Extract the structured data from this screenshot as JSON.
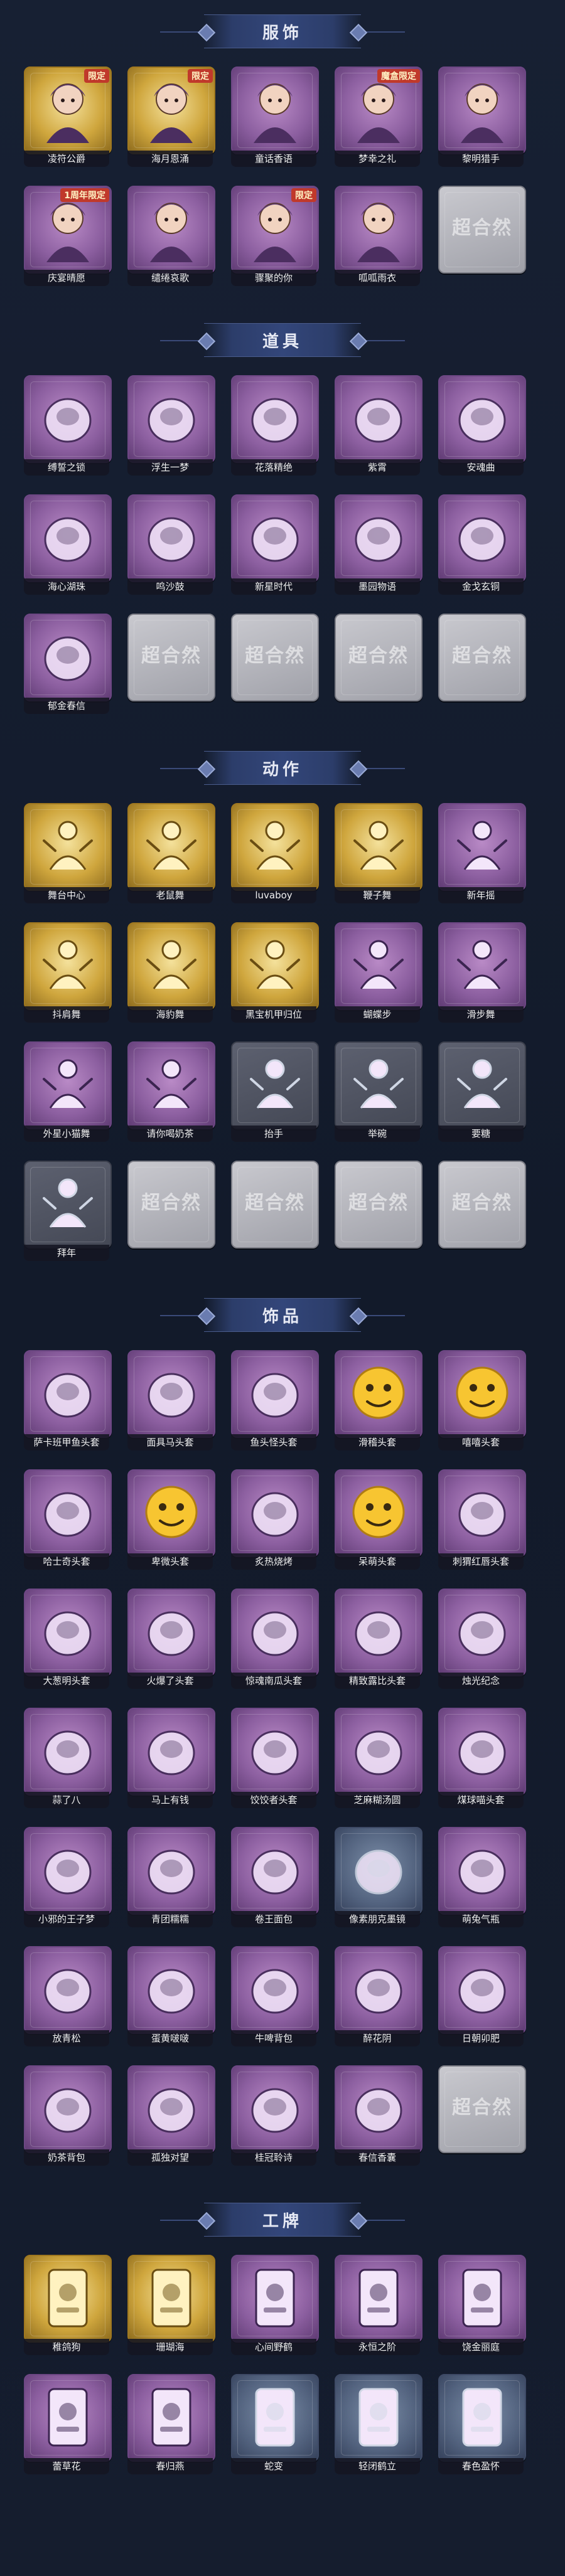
{
  "sections": [
    {
      "title": "服饰",
      "items": [
        {
          "label": "凌符公爵",
          "style": "gold",
          "tag": "限定",
          "icon": "costume-icon"
        },
        {
          "label": "海月恩涌",
          "style": "gold",
          "tag": "限定",
          "icon": "costume-icon"
        },
        {
          "label": "童话香语",
          "style": "purple",
          "tag": "",
          "icon": "costume-icon"
        },
        {
          "label": "梦幸之礼",
          "style": "purple",
          "tag": "魔盒限定",
          "icon": "costume-icon"
        },
        {
          "label": "黎明猎手",
          "style": "purple",
          "tag": "",
          "icon": "costume-icon"
        },
        {
          "label": "庆宴晴愿",
          "style": "purple",
          "tag": "1周年限定",
          "icon": "costume-icon"
        },
        {
          "label": "缱绻哀歌",
          "style": "purple",
          "tag": "",
          "icon": "costume-icon"
        },
        {
          "label": "骤聚的你",
          "style": "purple",
          "tag": "限定",
          "icon": "costume-icon"
        },
        {
          "label": "呱呱雨衣",
          "style": "purple",
          "tag": "",
          "icon": "costume-icon"
        },
        {
          "label": "",
          "style": "placeholder",
          "tag": "",
          "icon": "watermark-icon"
        }
      ]
    },
    {
      "title": "道具",
      "items": [
        {
          "label": "缚誓之锁",
          "style": "purple",
          "tag": "",
          "icon": "chain-icon"
        },
        {
          "label": "浮生一梦",
          "style": "purple",
          "tag": "",
          "icon": "hourglass-icon"
        },
        {
          "label": "花落精绝",
          "style": "purple",
          "tag": "",
          "icon": "flower-icon"
        },
        {
          "label": "紫霄",
          "style": "purple",
          "tag": "",
          "icon": "pendant-icon"
        },
        {
          "label": "安魂曲",
          "style": "purple",
          "tag": "",
          "icon": "blade-icon"
        },
        {
          "label": "海心湖珠",
          "style": "purple",
          "tag": "",
          "icon": "shell-icon"
        },
        {
          "label": "鸣沙鼓",
          "style": "purple",
          "tag": "",
          "icon": "drum-icon"
        },
        {
          "label": "新星时代",
          "style": "purple",
          "tag": "",
          "icon": "revolver-icon"
        },
        {
          "label": "墨园物语",
          "style": "purple",
          "tag": "",
          "icon": "medkit-icon"
        },
        {
          "label": "金戈玄铜",
          "style": "purple",
          "tag": "",
          "icon": "canister-icon"
        },
        {
          "label": "郁金春信",
          "style": "purple",
          "tag": "",
          "icon": "umbrella-icon"
        },
        {
          "label": "",
          "style": "placeholder",
          "tag": "",
          "icon": "watermark-icon"
        },
        {
          "label": "",
          "style": "placeholder",
          "tag": "",
          "icon": "watermark-icon"
        },
        {
          "label": "",
          "style": "placeholder",
          "tag": "",
          "icon": "watermark-icon"
        },
        {
          "label": "",
          "style": "placeholder",
          "tag": "",
          "icon": "watermark-icon"
        }
      ]
    },
    {
      "title": "动作",
      "items": [
        {
          "label": "舞台中心",
          "style": "gold",
          "tag": "",
          "icon": "pose-icon"
        },
        {
          "label": "老鼠舞",
          "style": "gold",
          "tag": "",
          "icon": "pose-icon"
        },
        {
          "label": "luvaboy",
          "style": "gold",
          "tag": "",
          "icon": "pose-icon"
        },
        {
          "label": "鞭子舞",
          "style": "gold",
          "tag": "",
          "icon": "pose-icon"
        },
        {
          "label": "新年摇",
          "style": "purple",
          "tag": "",
          "icon": "pose-icon"
        },
        {
          "label": "抖肩舞",
          "style": "gold",
          "tag": "",
          "icon": "pose-icon"
        },
        {
          "label": "海豹舞",
          "style": "gold",
          "tag": "",
          "icon": "pose-icon"
        },
        {
          "label": "黑宝机甲归位",
          "style": "gold",
          "tag": "",
          "icon": "pose-icon"
        },
        {
          "label": "蝴蝶步",
          "style": "purple",
          "tag": "",
          "icon": "pose-icon"
        },
        {
          "label": "滑步舞",
          "style": "purple",
          "tag": "",
          "icon": "pose-icon"
        },
        {
          "label": "外星小猫舞",
          "style": "purple",
          "tag": "",
          "icon": "pose-icon"
        },
        {
          "label": "请你喝奶茶",
          "style": "purple",
          "tag": "",
          "icon": "pose-icon"
        },
        {
          "label": "抬手",
          "style": "gray",
          "tag": "",
          "icon": "pose-icon"
        },
        {
          "label": "举碗",
          "style": "gray",
          "tag": "",
          "icon": "pose-icon"
        },
        {
          "label": "要糖",
          "style": "gray",
          "tag": "",
          "icon": "pose-icon"
        },
        {
          "label": "拜年",
          "style": "gray",
          "tag": "",
          "icon": "pose-icon"
        },
        {
          "label": "",
          "style": "placeholder",
          "tag": "",
          "icon": "watermark-icon"
        },
        {
          "label": "",
          "style": "placeholder",
          "tag": "",
          "icon": "watermark-icon"
        },
        {
          "label": "",
          "style": "placeholder",
          "tag": "",
          "icon": "watermark-icon"
        },
        {
          "label": "",
          "style": "placeholder",
          "tag": "",
          "icon": "watermark-icon"
        }
      ]
    },
    {
      "title": "饰品",
      "items": [
        {
          "label": "萨卡班甲鱼头套",
          "style": "purple",
          "tag": "",
          "icon": "fish-head-icon"
        },
        {
          "label": "面具马头套",
          "style": "purple",
          "tag": "",
          "icon": "horse-head-icon"
        },
        {
          "label": "鱼头怪头套",
          "style": "purple",
          "tag": "",
          "icon": "green-fish-icon"
        },
        {
          "label": "滑稽头套",
          "style": "purple",
          "tag": "",
          "icon": "emoji-icon"
        },
        {
          "label": "嘻嘻头套",
          "style": "purple",
          "tag": "",
          "icon": "emoji-icon"
        },
        {
          "label": "哈士奇头套",
          "style": "purple",
          "tag": "",
          "icon": "dog-head-icon"
        },
        {
          "label": "卑微头套",
          "style": "purple",
          "tag": "",
          "icon": "emoji-icon"
        },
        {
          "label": "炙热烧烤",
          "style": "purple",
          "tag": "",
          "icon": "toast-icon"
        },
        {
          "label": "呆萌头套",
          "style": "purple",
          "tag": "",
          "icon": "emoji-icon"
        },
        {
          "label": "刺猬红唇头套",
          "style": "purple",
          "tag": "",
          "icon": "pikachu-icon"
        },
        {
          "label": "大葱明头套",
          "style": "purple",
          "tag": "",
          "icon": "cabbage-icon"
        },
        {
          "label": "火爆了头套",
          "style": "purple",
          "tag": "",
          "icon": "flame-icon"
        },
        {
          "label": "惊魂南瓜头套",
          "style": "purple",
          "tag": "",
          "icon": "pumpkin-icon"
        },
        {
          "label": "精致露比头套",
          "style": "purple",
          "tag": "",
          "icon": "pig-icon"
        },
        {
          "label": "烛光纪念",
          "style": "purple",
          "tag": "",
          "icon": "candle-icon"
        },
        {
          "label": "蒜了八",
          "style": "purple",
          "tag": "",
          "icon": "garlic-icon"
        },
        {
          "label": "马上有钱",
          "style": "purple",
          "tag": "",
          "icon": "bird-icon"
        },
        {
          "label": "饺饺者头套",
          "style": "purple",
          "tag": "",
          "icon": "dumpling-icon"
        },
        {
          "label": "芝麻糊汤圆",
          "style": "purple",
          "tag": "",
          "icon": "dumpling-icon"
        },
        {
          "label": "煤球喵头套",
          "style": "purple",
          "tag": "",
          "icon": "cat-head-icon"
        },
        {
          "label": "小邪的王子梦",
          "style": "purple",
          "tag": "",
          "icon": "prince-icon"
        },
        {
          "label": "青团糯糯",
          "style": "purple",
          "tag": "",
          "icon": "green-bun-icon"
        },
        {
          "label": "卷王面包",
          "style": "purple",
          "tag": "",
          "icon": "bread-icon"
        },
        {
          "label": "像素朋克墨镜",
          "style": "blue",
          "tag": "",
          "icon": "sunglasses-icon"
        },
        {
          "label": "萌兔气瓶",
          "style": "purple",
          "tag": "",
          "icon": "balloon-icon"
        },
        {
          "label": "放青松",
          "style": "purple",
          "tag": "",
          "icon": "bonsai-icon"
        },
        {
          "label": "蛋黄啵啵",
          "style": "purple",
          "tag": "",
          "icon": "egg-icon"
        },
        {
          "label": "牛啤背包",
          "style": "purple",
          "tag": "",
          "icon": "backpack-icon"
        },
        {
          "label": "醉花阴",
          "style": "purple",
          "tag": "",
          "icon": "charm-icon"
        },
        {
          "label": "日朝卯肥",
          "style": "purple",
          "tag": "",
          "icon": "plush-icon"
        },
        {
          "label": "奶茶背包",
          "style": "purple",
          "tag": "",
          "icon": "backpack-icon"
        },
        {
          "label": "孤独对望",
          "style": "purple",
          "tag": "",
          "icon": "charm-icon"
        },
        {
          "label": "桂冠聆诗",
          "style": "purple",
          "tag": "",
          "icon": "charm-icon"
        },
        {
          "label": "春信香囊",
          "style": "purple",
          "tag": "",
          "icon": "charm-icon"
        },
        {
          "label": "",
          "style": "placeholder",
          "tag": "",
          "icon": "watermark-icon"
        }
      ]
    },
    {
      "title": "工牌",
      "items": [
        {
          "label": "稚鸽狗",
          "style": "gold",
          "tag": "",
          "icon": "badge-icon"
        },
        {
          "label": "珊瑚海",
          "style": "gold",
          "tag": "",
          "icon": "badge-icon"
        },
        {
          "label": "心间野鹤",
          "style": "purple",
          "tag": "",
          "icon": "badge-icon"
        },
        {
          "label": "永恒之阶",
          "style": "purple",
          "tag": "",
          "icon": "badge-icon"
        },
        {
          "label": "饶金丽庭",
          "style": "purple",
          "tag": "",
          "icon": "badge-icon"
        },
        {
          "label": "蕾草花",
          "style": "purple",
          "tag": "",
          "icon": "badge-icon"
        },
        {
          "label": "春归燕",
          "style": "purple",
          "tag": "",
          "icon": "badge-icon"
        },
        {
          "label": "蛇变",
          "style": "blue",
          "tag": "",
          "icon": "badge-icon"
        },
        {
          "label": "轻闭鹤立",
          "style": "blue",
          "tag": "",
          "icon": "badge-icon"
        },
        {
          "label": "春色盈怀",
          "style": "blue",
          "tag": "",
          "icon": "badge-icon"
        }
      ]
    }
  ],
  "watermark_text": "超合然",
  "colors": {
    "purple": "#8c5fa0",
    "gold": "#cfa63d",
    "gray": "#505462",
    "placeholder": "#b4b5bc",
    "header": "#33467a",
    "label_bg": "#14161f"
  }
}
